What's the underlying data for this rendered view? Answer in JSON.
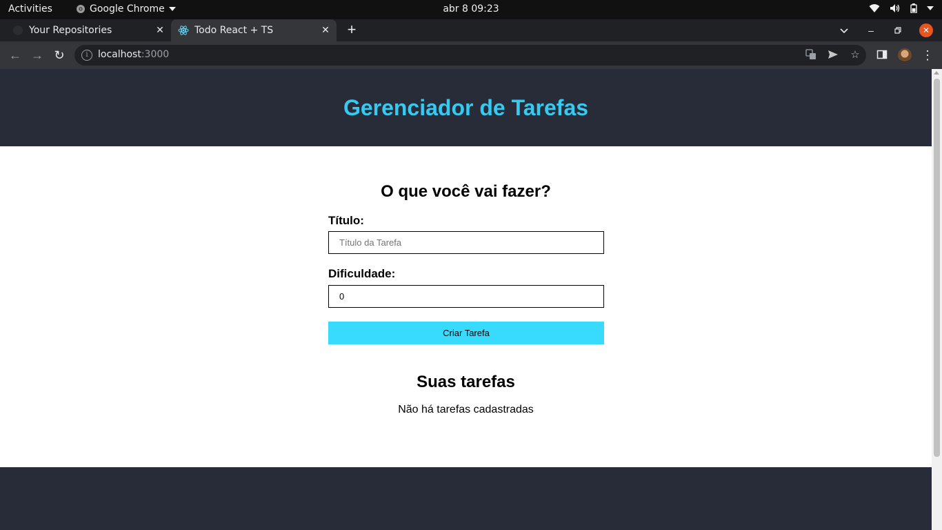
{
  "os": {
    "activities": "Activities",
    "app_name": "Google Chrome",
    "clock": "abr 8  09:23"
  },
  "browser": {
    "tabs": [
      {
        "title": "Your Repositories",
        "active": false,
        "icon": "github-icon"
      },
      {
        "title": "Todo React + TS",
        "active": true,
        "icon": "react-icon"
      }
    ],
    "url_host": "localhost",
    "url_port": ":3000"
  },
  "page": {
    "header_title": "Gerenciador de Tarefas",
    "form_title": "O que você vai fazer?",
    "title_label": "Título:",
    "title_placeholder": "Título da Tarefa",
    "title_value": "",
    "difficulty_label": "Dificuldade:",
    "difficulty_value": "0",
    "submit_label": "Criar Tarefa",
    "list_title": "Suas tarefas",
    "empty_message": "Não há tarefas cadastradas"
  },
  "colors": {
    "header_bg": "#282c38",
    "accent_title": "#38c9f0",
    "button_bg": "#38dbfd"
  }
}
